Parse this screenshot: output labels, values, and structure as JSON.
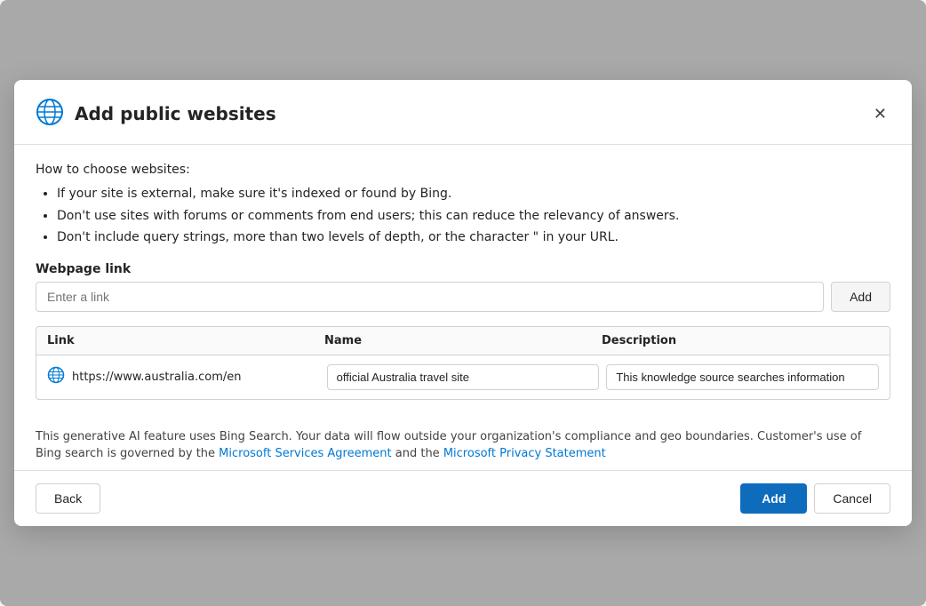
{
  "modal": {
    "title": "Add public websites",
    "close_label": "×"
  },
  "instructions": {
    "heading": "How to choose websites:",
    "bullets": [
      "If your site is external, make sure it's indexed or found by Bing.",
      "Don't use sites with forums or comments from end users; this can reduce the relevancy of answers.",
      "Don't include query strings, more than two levels of depth, or the character \" in your URL."
    ]
  },
  "form": {
    "field_label": "Webpage link",
    "input_placeholder": "Enter a link",
    "add_link_button": "Add"
  },
  "table": {
    "columns": [
      "Link",
      "Name",
      "Description"
    ],
    "rows": [
      {
        "link": "https://www.australia.com/en",
        "name": "official Australia travel site",
        "description": "This knowledge source searches information"
      }
    ]
  },
  "disclaimer": {
    "text_before": "This generative AI feature uses Bing Search. Your data will flow outside your organization's compliance and geo boundaries. Customer's use of Bing search is governed by the ",
    "link1_label": "Microsoft Services Agreement",
    "link1_url": "#",
    "text_middle": " and the ",
    "link2_label": "Microsoft Privacy Statement",
    "link2_url": "#"
  },
  "footer": {
    "back_button": "Back",
    "add_button": "Add",
    "cancel_button": "Cancel"
  }
}
